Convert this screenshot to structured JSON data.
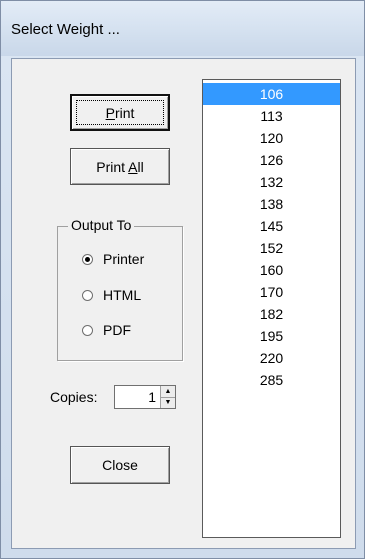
{
  "window": {
    "title": "Select Weight ..."
  },
  "buttons": {
    "print": {
      "pre": "",
      "accel": "P",
      "post": "rint"
    },
    "print_all": {
      "pre": "Print ",
      "accel": "A",
      "post": "ll"
    },
    "close": "Close"
  },
  "output_group": {
    "label": "Output To",
    "options": [
      {
        "label": "Printer",
        "checked": true
      },
      {
        "label": "HTML",
        "checked": false
      },
      {
        "label": "PDF",
        "checked": false
      }
    ]
  },
  "copies": {
    "label": "Copies:",
    "value": "1"
  },
  "weights": {
    "selected_index": 0,
    "items": [
      "106",
      "113",
      "120",
      "126",
      "132",
      "138",
      "145",
      "152",
      "160",
      "170",
      "182",
      "195",
      "220",
      "285"
    ]
  },
  "colors": {
    "selection": "#3399ff",
    "dialog_bg": "#f0f0f0"
  }
}
